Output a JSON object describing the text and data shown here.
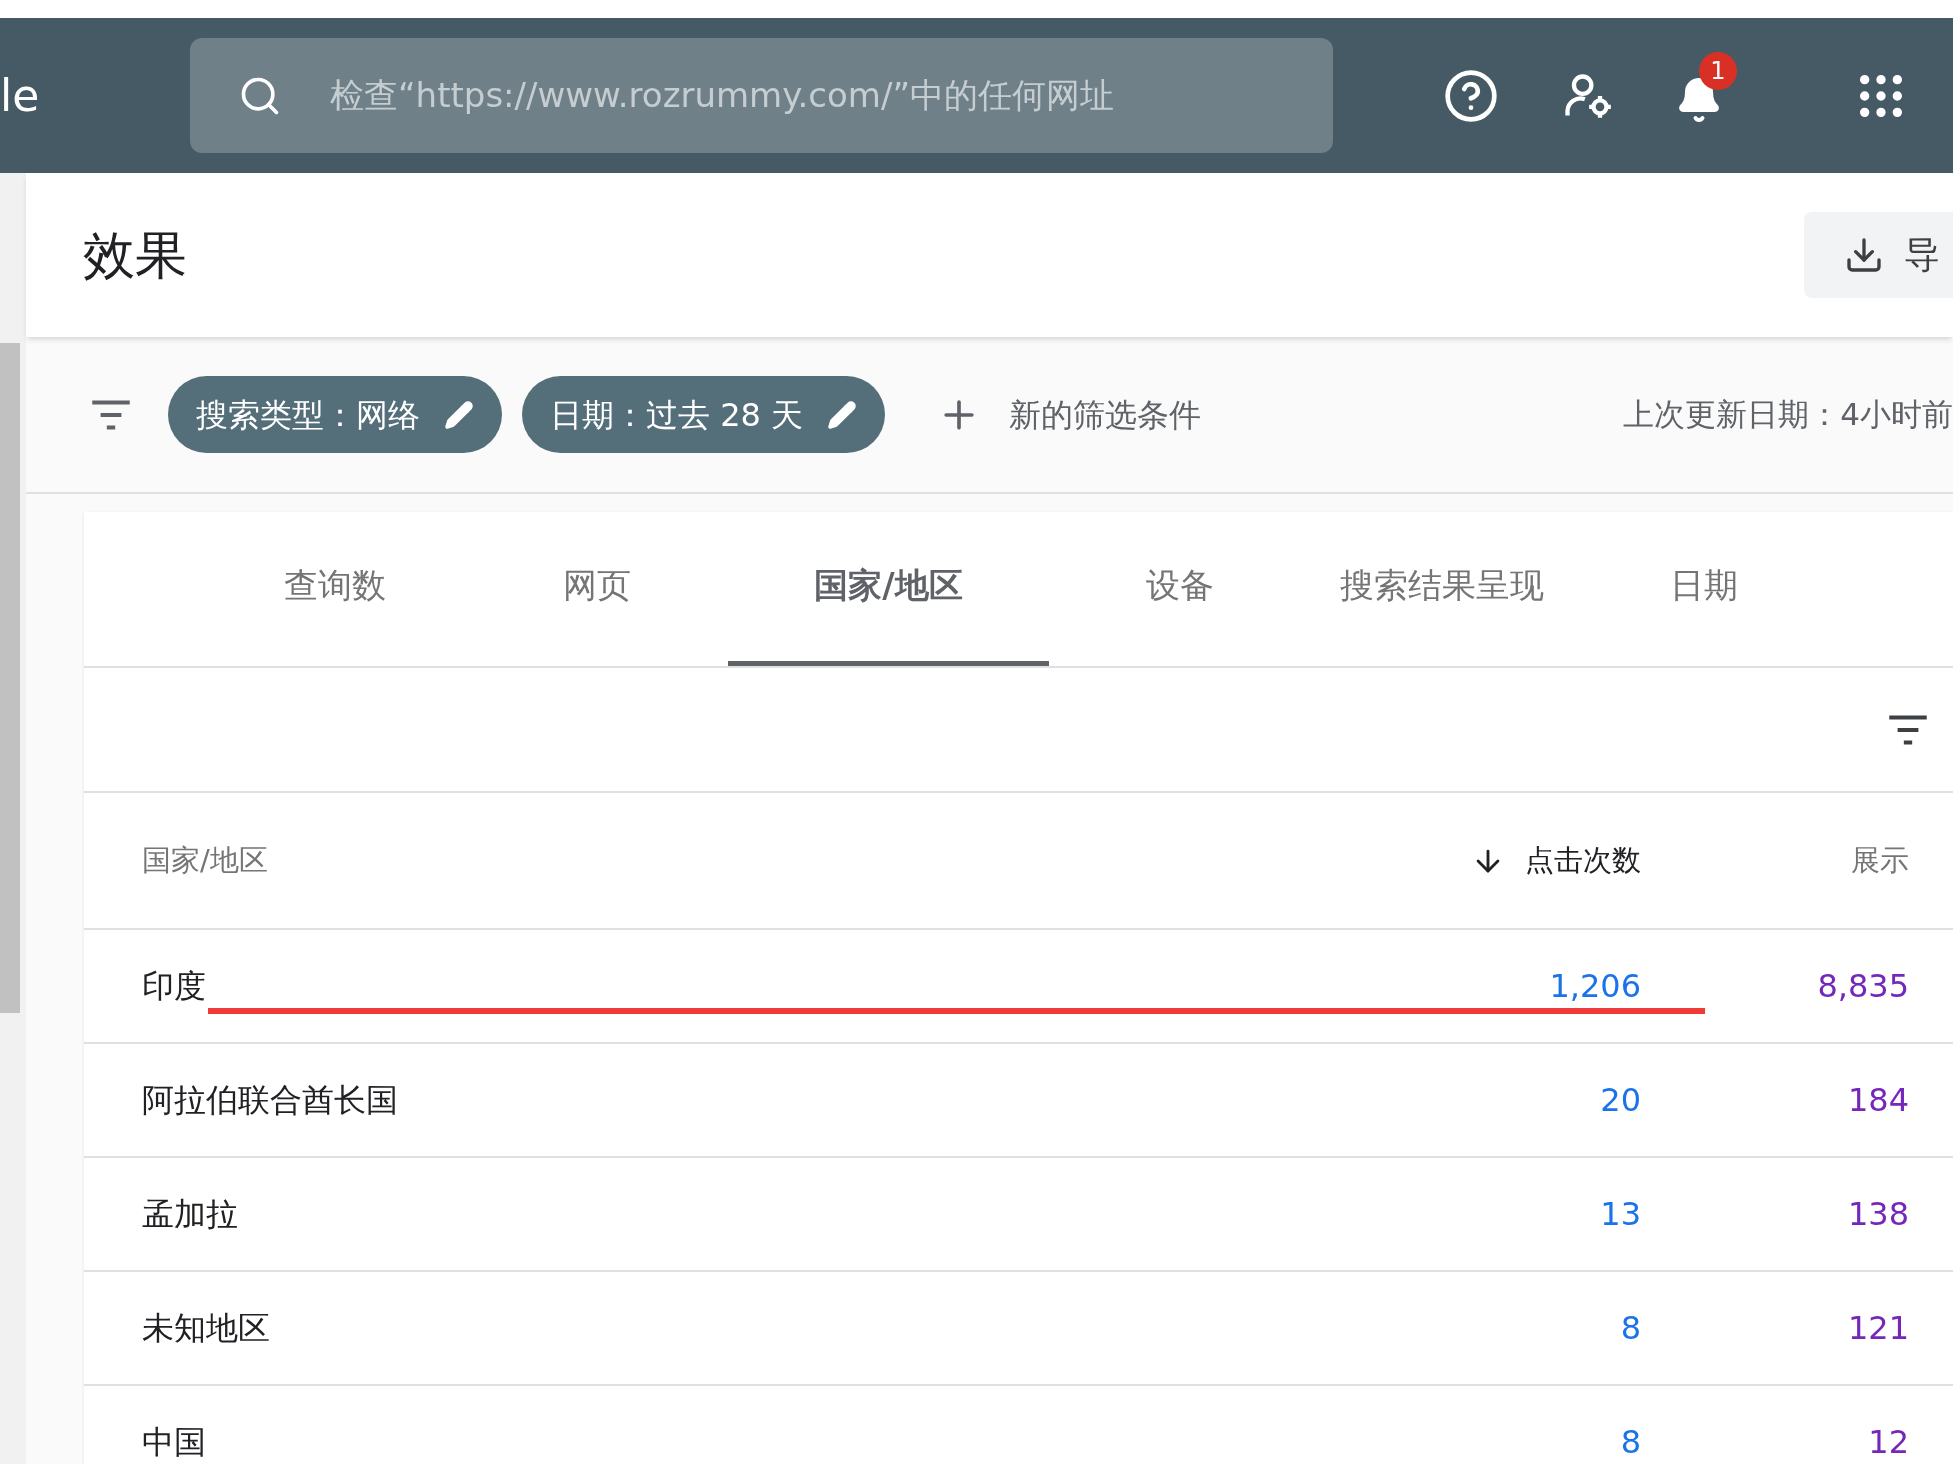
{
  "header": {
    "logo_text": "le",
    "search": {
      "placeholder": "检查“https://www.rozrummy.com/”中的任何网址"
    },
    "notification_count": "1"
  },
  "page": {
    "title": "效果",
    "export_label": "导"
  },
  "filters": {
    "chips": [
      {
        "label": "搜索类型：网络"
      },
      {
        "label": "日期：过去 28 天"
      }
    ],
    "add_filter": "新的筛选条件",
    "last_updated": "上次更新日期：4小时前"
  },
  "tabs": [
    {
      "label": "查询数",
      "selected": false
    },
    {
      "label": "网页",
      "selected": false
    },
    {
      "label": "国家/地区",
      "selected": true
    },
    {
      "label": "设备",
      "selected": false
    },
    {
      "label": "搜索结果呈现",
      "selected": false
    },
    {
      "label": "日期",
      "selected": false
    }
  ],
  "table": {
    "columns": [
      {
        "label": "国家/地区",
        "sorted": false
      },
      {
        "label": "点击次数",
        "sorted": true
      },
      {
        "label": "展示",
        "sorted": false
      }
    ],
    "rows": [
      {
        "country": "印度",
        "clicks": "1,206",
        "impressions": "8,835",
        "underlined": true
      },
      {
        "country": "阿拉伯联合酋长国",
        "clicks": "20",
        "impressions": "184",
        "underlined": false
      },
      {
        "country": "孟加拉",
        "clicks": "13",
        "impressions": "138",
        "underlined": false
      },
      {
        "country": "未知地区",
        "clicks": "8",
        "impressions": "121",
        "underlined": false
      },
      {
        "country": "中国",
        "clicks": "8",
        "impressions": "12",
        "underlined": false
      }
    ]
  }
}
